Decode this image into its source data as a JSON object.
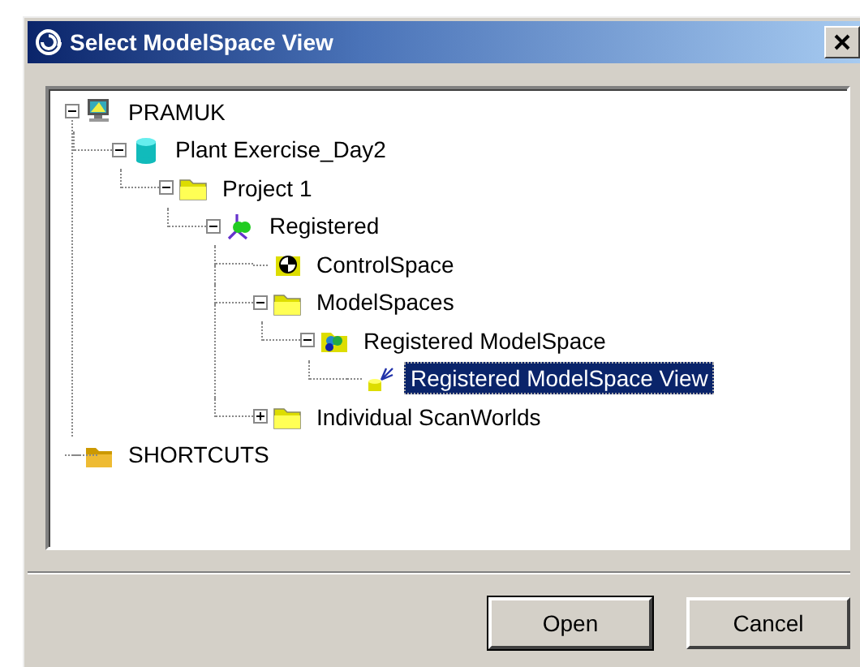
{
  "window": {
    "title": "Select ModelSpace View"
  },
  "tree": [
    {
      "label": "PRAMUK",
      "kind": "computer",
      "expanded": true,
      "selected": false,
      "children": [
        {
          "label": "Plant Exercise_Day2",
          "kind": "database",
          "expanded": true,
          "selected": false,
          "children": [
            {
              "label": "Project 1",
              "kind": "folder",
              "expanded": true,
              "selected": false,
              "children": [
                {
                  "label": "Registered",
                  "kind": "axes",
                  "expanded": true,
                  "selected": false,
                  "children": [
                    {
                      "label": "ControlSpace",
                      "kind": "control",
                      "selected": false
                    },
                    {
                      "label": "ModelSpaces",
                      "kind": "folder",
                      "expanded": true,
                      "selected": false,
                      "children": [
                        {
                          "label": "Registered ModelSpace",
                          "kind": "modelspace",
                          "expanded": true,
                          "selected": false,
                          "children": [
                            {
                              "label": "Registered ModelSpace View",
                              "kind": "view",
                              "selected": true
                            }
                          ]
                        }
                      ]
                    },
                    {
                      "label": "Individual ScanWorlds",
                      "kind": "folder",
                      "expanded": false,
                      "selected": false
                    }
                  ]
                }
              ]
            }
          ]
        }
      ]
    },
    {
      "label": "SHORTCUTS",
      "kind": "shortcut",
      "selected": false
    }
  ],
  "buttons": [
    {
      "label": "Open",
      "default": true
    },
    {
      "label": "Cancel",
      "default": false
    }
  ]
}
